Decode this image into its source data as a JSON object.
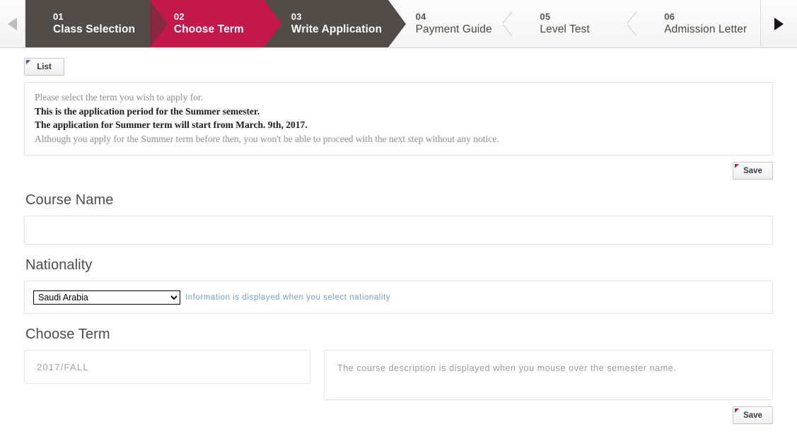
{
  "stepbar": {
    "prev_icon": "triangle-left-icon",
    "next_icon": "triangle-right-icon",
    "steps": [
      {
        "num": "01",
        "label": "Class Selection",
        "state": "dark"
      },
      {
        "num": "02",
        "label": "Choose Term",
        "state": "active"
      },
      {
        "num": "03",
        "label": "Write Application",
        "state": "dark"
      },
      {
        "num": "04",
        "label": "Payment Guide",
        "state": "light"
      },
      {
        "num": "05",
        "label": "Level Test",
        "state": "light"
      },
      {
        "num": "06",
        "label": "Admission Letter",
        "state": "light"
      }
    ],
    "active_color": "#c4184a",
    "dark_color": "#514c47"
  },
  "toolbar": {
    "list_label": "List"
  },
  "notice": {
    "line1": "Please select the term you wish to apply for.",
    "line2": "This is the application period for the Summer semester.",
    "line3": "The application for Summer term will start from March. 9th, 2017.",
    "line4": "Although you apply for the Summer term before then, you won't be able to proceed with the next step without any notice."
  },
  "save_top": {
    "label": "Save"
  },
  "course_name": {
    "title": "Course Name",
    "value": "",
    "placeholder": ""
  },
  "nationality": {
    "title": "Nationality",
    "selected": "Saudi Arabia",
    "options": [
      "Saudi Arabia"
    ],
    "hint": "Information is displayed when you select nationality",
    "hint_color": "#7a9ec4"
  },
  "choose_term": {
    "title": "Choose Term",
    "term_value": "2017/FALL",
    "description": "The course description is displayed when you mouse over the semester name."
  },
  "save_bottom": {
    "label": "Save"
  }
}
